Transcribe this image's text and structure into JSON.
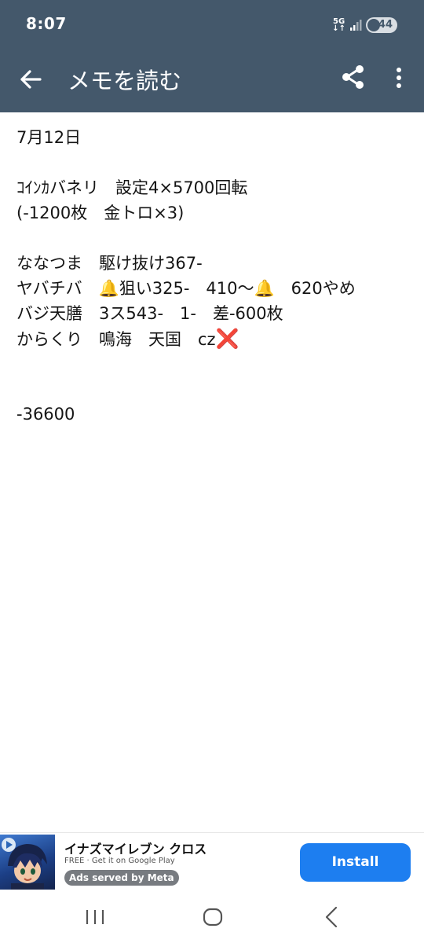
{
  "status_bar": {
    "time": "8:07",
    "network_top": "5G",
    "network_bottom": "↓↑",
    "battery": "44"
  },
  "app_bar": {
    "title": "メモを読む",
    "icons": [
      "back-arrow-icon",
      "share-icon",
      "more-vert-icon"
    ]
  },
  "memo": {
    "lines": {
      "l1": "7月12日",
      "l2": "ｺｲﾝｶバネリ　設定4×5700回転",
      "l3": "(-1200枚　金トロ×3)",
      "l4": "ななつま　駆け抜け367-",
      "l5a": "ヤバチバ　",
      "l5b": "🔔",
      "l5c": "狙い325-　410～",
      "l5d": "🔔",
      "l5e": "　620やめ",
      "l6": "バジ天膳　3ス543-　1-　差-600枚",
      "l7a": "からくり　鳴海　天国　cz",
      "l7b": "❌",
      "l8": "-36600"
    },
    "accent_bell": "#f3a323",
    "accent_cross": "#e0262b"
  },
  "ad": {
    "title": "イナズマイレブン クロス",
    "subtitle": "FREE · Get it on Google Play",
    "badge": "Ads served by Meta",
    "install": "Install"
  },
  "nav_bar": {
    "icons": [
      "recents-icon",
      "home-icon",
      "back-icon"
    ]
  },
  "colors": {
    "header": "#44586b",
    "install_button": "#1d7ef0"
  }
}
